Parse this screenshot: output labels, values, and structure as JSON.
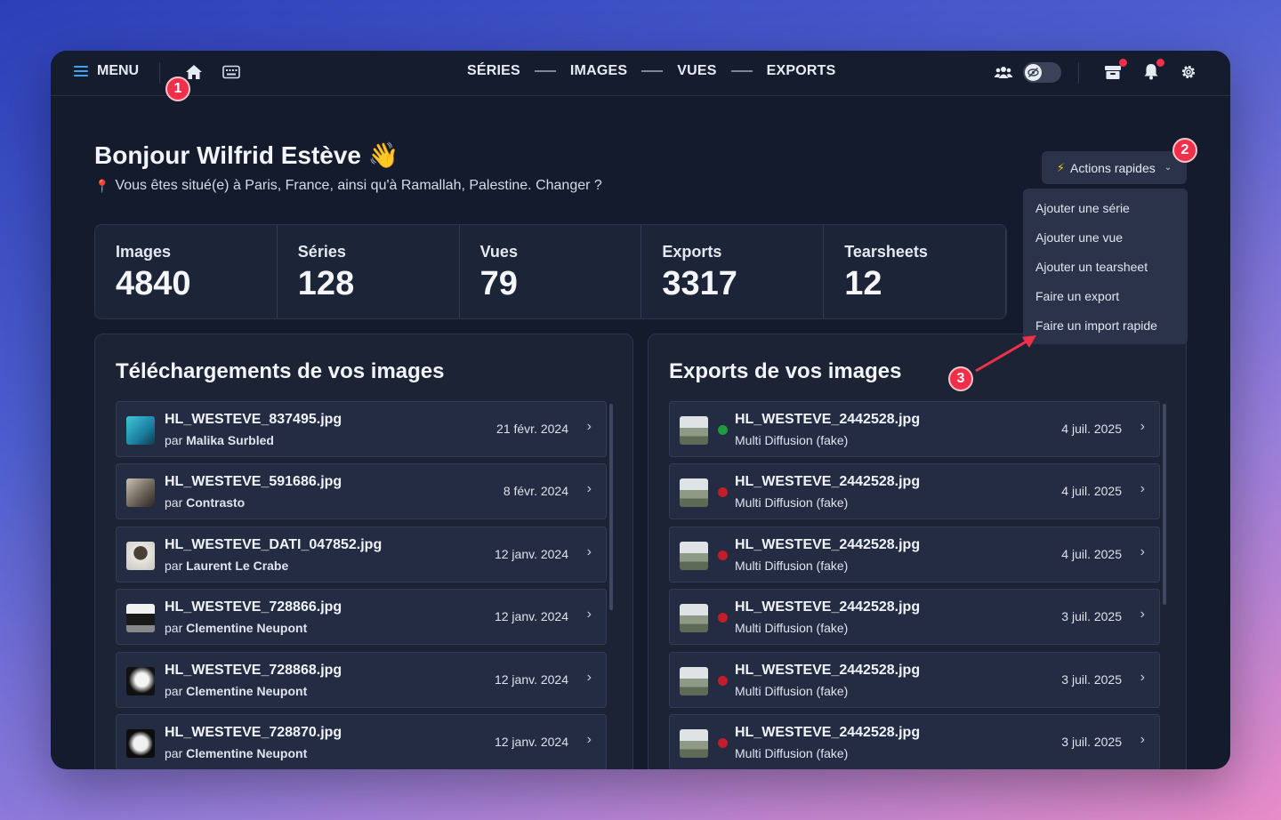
{
  "topbar": {
    "menu_label": "MENU",
    "nav": [
      "SÉRIES",
      "IMAGES",
      "VUES",
      "EXPORTS"
    ]
  },
  "badges": {
    "one": "1",
    "two": "2",
    "three": "3"
  },
  "header": {
    "greeting": "Bonjour Wilfrid Estève 👋",
    "location": "Vous êtes situé(e) à Paris, France, ainsi qu'à Ramallah, Palestine. Changer ?"
  },
  "actions": {
    "button_label": "Actions rapides",
    "items": [
      "Ajouter une série",
      "Ajouter une vue",
      "Ajouter un tearsheet",
      "Faire un export",
      "Faire un import rapide"
    ]
  },
  "stats": [
    {
      "label": "Images",
      "value": "4840"
    },
    {
      "label": "Séries",
      "value": "128"
    },
    {
      "label": "Vues",
      "value": "79"
    },
    {
      "label": "Exports",
      "value": "3317"
    },
    {
      "label": "Tearsheets",
      "value": "12"
    }
  ],
  "uploads": {
    "title": "Téléchargements de vos images",
    "by_prefix": "par",
    "rows": [
      {
        "file": "HL_WESTEVE_837495.jpg",
        "author": "Malika Surbled",
        "date": "21 févr. 2024"
      },
      {
        "file": "HL_WESTEVE_591686.jpg",
        "author": "Contrasto",
        "date": "8 févr. 2024"
      },
      {
        "file": "HL_WESTEVE_DATI_047852.jpg",
        "author": "Laurent Le Crabe",
        "date": "12 janv. 2024"
      },
      {
        "file": "HL_WESTEVE_728866.jpg",
        "author": "Clementine Neupont",
        "date": "12 janv. 2024"
      },
      {
        "file": "HL_WESTEVE_728868.jpg",
        "author": "Clementine Neupont",
        "date": "12 janv. 2024"
      },
      {
        "file": "HL_WESTEVE_728870.jpg",
        "author": "Clementine Neupont",
        "date": "12 janv. 2024"
      }
    ]
  },
  "exports": {
    "title": "Exports de vos images",
    "rows": [
      {
        "file": "HL_WESTEVE_2442528.jpg",
        "target": "Multi Diffusion (fake)",
        "date": "4 juil. 2025",
        "status_color": "#1f9a3f"
      },
      {
        "file": "HL_WESTEVE_2442528.jpg",
        "target": "Multi Diffusion (fake)",
        "date": "4 juil. 2025",
        "status_color": "#c21d2b"
      },
      {
        "file": "HL_WESTEVE_2442528.jpg",
        "target": "Multi Diffusion (fake)",
        "date": "4 juil. 2025",
        "status_color": "#c21d2b"
      },
      {
        "file": "HL_WESTEVE_2442528.jpg",
        "target": "Multi Diffusion (fake)",
        "date": "3 juil. 2025",
        "status_color": "#c21d2b"
      },
      {
        "file": "HL_WESTEVE_2442528.jpg",
        "target": "Multi Diffusion (fake)",
        "date": "3 juil. 2025",
        "status_color": "#c21d2b"
      },
      {
        "file": "HL_WESTEVE_2442528.jpg",
        "target": "Multi Diffusion (fake)",
        "date": "3 juil. 2025",
        "status_color": "#c21d2b"
      }
    ]
  },
  "colors": {
    "accent": "#3fa3f2",
    "badge": "#f0304a",
    "background": "#141b2d"
  }
}
